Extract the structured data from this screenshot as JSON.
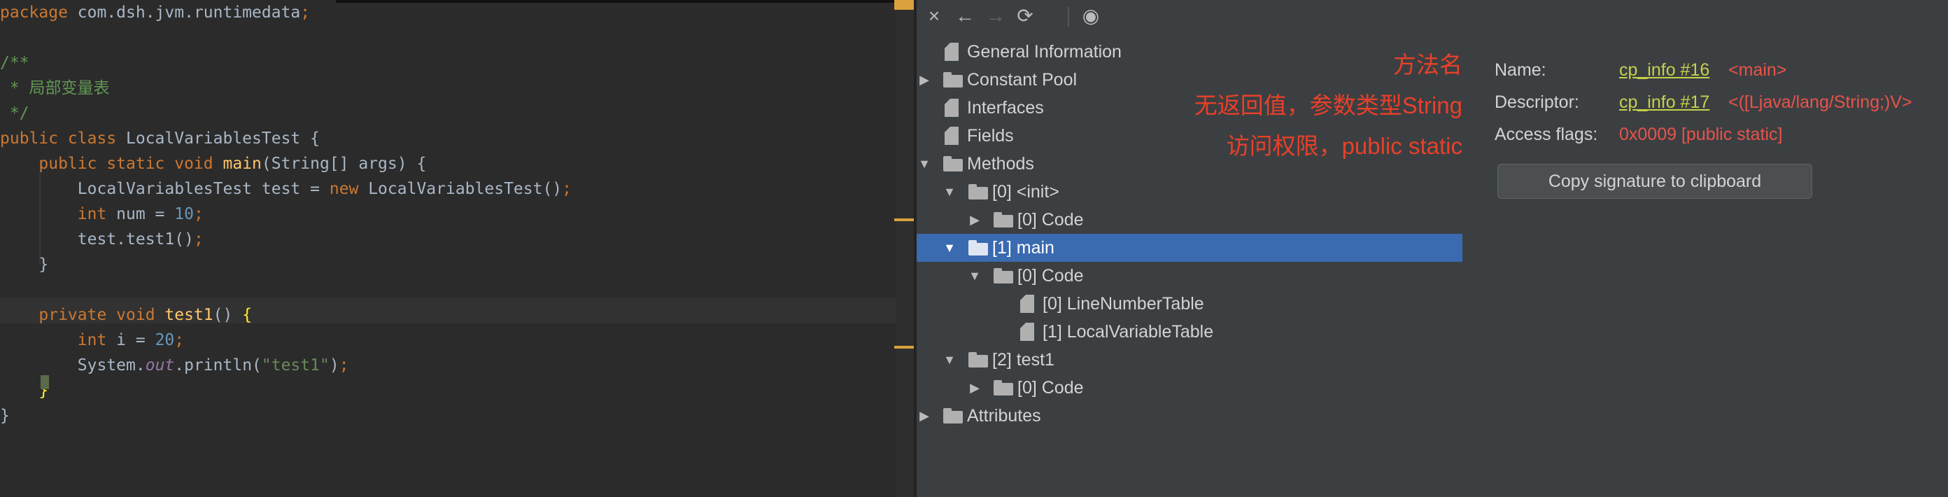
{
  "editor": {
    "lines": [
      {
        "t": [
          {
            "c": "kw",
            "v": "package "
          },
          {
            "c": "",
            "v": "com.dsh.jvm.runtimedata"
          },
          {
            "c": "kw",
            "v": ";"
          }
        ]
      },
      {
        "t": []
      },
      {
        "t": [
          {
            "c": "cm",
            "v": "/**"
          }
        ]
      },
      {
        "t": [
          {
            "c": "cm",
            "v": " * 局部变量表"
          }
        ]
      },
      {
        "t": [
          {
            "c": "cm",
            "v": " */"
          }
        ]
      },
      {
        "t": [
          {
            "c": "kw",
            "v": "public class "
          },
          {
            "c": "",
            "v": "LocalVariablesTest {"
          }
        ]
      },
      {
        "t": [
          {
            "c": "",
            "v": "    "
          },
          {
            "c": "kw",
            "v": "public static void "
          },
          {
            "c": "fn",
            "v": "main"
          },
          {
            "c": "",
            "v": "(String[] args) {"
          }
        ]
      },
      {
        "t": [
          {
            "c": "",
            "v": "        LocalVariablesTest test = "
          },
          {
            "c": "kw",
            "v": "new "
          },
          {
            "c": "",
            "v": "LocalVariablesTest()"
          },
          {
            "c": "kw",
            "v": ";"
          }
        ]
      },
      {
        "t": [
          {
            "c": "",
            "v": "        "
          },
          {
            "c": "kw",
            "v": "int "
          },
          {
            "c": "",
            "v": "num = "
          },
          {
            "c": "num",
            "v": "10"
          },
          {
            "c": "kw",
            "v": ";"
          }
        ]
      },
      {
        "t": [
          {
            "c": "",
            "v": "        test.test1()"
          },
          {
            "c": "kw",
            "v": ";"
          }
        ]
      },
      {
        "t": [
          {
            "c": "",
            "v": "    }"
          }
        ]
      },
      {
        "t": []
      },
      {
        "t": [
          {
            "c": "",
            "v": "    "
          },
          {
            "c": "kw",
            "v": "private void "
          },
          {
            "c": "fn",
            "v": "test1"
          },
          {
            "c": "",
            "v": "() "
          },
          {
            "c": "brc",
            "v": "{"
          }
        ]
      },
      {
        "t": [
          {
            "c": "",
            "v": "        "
          },
          {
            "c": "kw",
            "v": "int "
          },
          {
            "c": "",
            "v": "i = "
          },
          {
            "c": "num",
            "v": "20"
          },
          {
            "c": "kw",
            "v": ";"
          }
        ]
      },
      {
        "t": [
          {
            "c": "",
            "v": "        System."
          },
          {
            "c": "fld",
            "v": "out"
          },
          {
            "c": "",
            "v": ".println("
          },
          {
            "c": "str",
            "v": "\"test1\""
          },
          {
            "c": "",
            "v": ")"
          },
          {
            "c": "kw",
            "v": ";"
          }
        ]
      },
      {
        "t": [
          {
            "c": "",
            "v": "    "
          },
          {
            "c": "brc",
            "v": "}"
          }
        ]
      },
      {
        "t": [
          {
            "c": "",
            "v": "}"
          }
        ]
      }
    ]
  },
  "toolbar": {
    "close_icon": "×",
    "back_icon": "←",
    "forward_icon": "→",
    "refresh_icon": "⟳",
    "browser_icon": "◉"
  },
  "tree": {
    "general_information": "General Information",
    "constant_pool": "Constant Pool",
    "interfaces": "Interfaces",
    "fields": "Fields",
    "methods": "Methods",
    "init": "[0] <init>",
    "init_code": "[0] Code",
    "main": "[1] main",
    "main_code": "[0] Code",
    "line_number_table": "[0] LineNumberTable",
    "local_variable_table": "[1] LocalVariableTable",
    "test1": "[2] test1",
    "test1_code": "[0] Code",
    "attributes": "Attributes"
  },
  "annotations": {
    "method_name": "方法名",
    "descriptor_note": "无返回值，参数类型String",
    "access_note": "访问权限，public static"
  },
  "info": {
    "name_label": "Name:",
    "name_link": "cp_info #16",
    "name_value": "<main>",
    "descriptor_label": "Descriptor:",
    "descriptor_link": "cp_info #17",
    "descriptor_value": "<([Ljava/lang/String;)V>",
    "access_label": "Access flags:",
    "access_value": "0x0009 [public static]",
    "copy_button": "Copy signature to clipboard"
  },
  "colors": {
    "editor_bg": "#2b2b2b",
    "panel_bg": "#3c3f41",
    "selection": "#3a6ab0",
    "annotation_red": "#e8402a",
    "link_yellow": "#c7d04a",
    "value_red": "#e8534a"
  }
}
